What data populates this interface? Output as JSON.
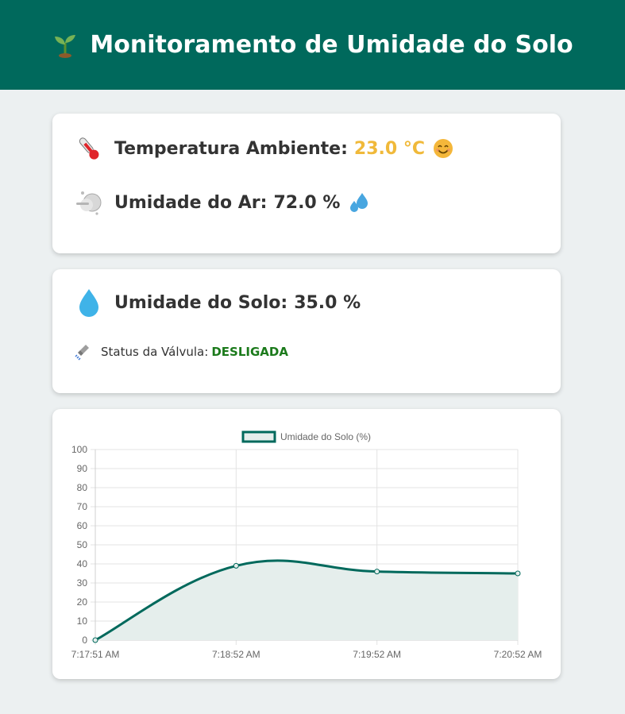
{
  "header": {
    "title": "Monitoramento de Umidade do Solo",
    "icon": "seedling-icon"
  },
  "environment": {
    "temperature_label": "Temperatura Ambiente:",
    "temperature_value": "23.0 °C",
    "temperature_icon": "thermometer-icon",
    "temperature_emoji": "smiley-face-icon",
    "temperature_color": "#f0b93a",
    "air_humidity_label": "Umidade do Ar:",
    "air_humidity_value": "72.0 %",
    "air_humidity_icon": "fog-cloud-icon",
    "air_humidity_emoji": "sweat-droplets-icon"
  },
  "soil": {
    "label": "Umidade do Solo:",
    "value": "35.0 %",
    "icon": "water-drop-icon",
    "valve_label": "Status da Válvula:",
    "valve_status": "DESLIGADA",
    "valve_status_color": "#1b7a1b",
    "valve_icon": "shower-icon"
  },
  "chart_data": {
    "type": "line",
    "categories": [
      "7:17:51 AM",
      "7:18:52 AM",
      "7:19:52 AM",
      "7:20:52 AM"
    ],
    "series": [
      {
        "name": "Umidade do Solo (%)",
        "values": [
          0,
          39,
          36,
          35
        ],
        "color": "#00695c",
        "fill": "#e5eeec"
      }
    ],
    "ylim": [
      0,
      100
    ],
    "yticks": [
      0,
      10,
      20,
      30,
      40,
      50,
      60,
      70,
      80,
      90,
      100
    ],
    "legend": "top",
    "grid": true
  }
}
